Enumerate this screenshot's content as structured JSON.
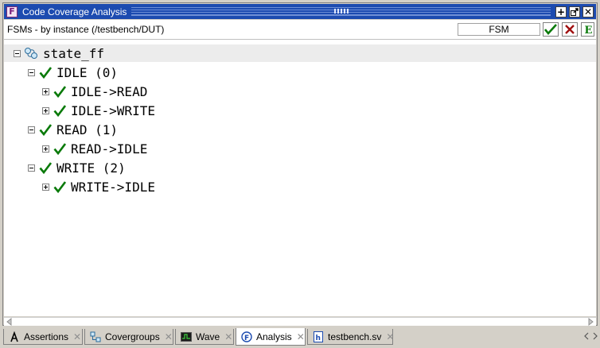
{
  "window": {
    "title": "Code Coverage Analysis",
    "title_buttons": [
      "+",
      "↗",
      "✕"
    ]
  },
  "toolbar": {
    "scope_label": "FSMs - by instance (/testbench/DUT)",
    "filter_value": "FSM",
    "buttons": [
      "check-icon",
      "x-icon",
      "e-icon"
    ]
  },
  "tree": {
    "root": {
      "label": "state_ff",
      "expanded": true
    },
    "states": [
      {
        "label": "IDLE (0)",
        "covered": true,
        "transitions": [
          {
            "label": "IDLE->READ",
            "covered": true
          },
          {
            "label": "IDLE->WRITE",
            "covered": true
          }
        ]
      },
      {
        "label": "READ (1)",
        "covered": true,
        "transitions": [
          {
            "label": "READ->IDLE",
            "covered": true
          }
        ]
      },
      {
        "label": "WRITE (2)",
        "covered": true,
        "transitions": [
          {
            "label": "WRITE->IDLE",
            "covered": true
          }
        ]
      }
    ]
  },
  "tabs": [
    {
      "label": "Assertions",
      "icon": "assertions-icon",
      "active": false
    },
    {
      "label": "Covergroups",
      "icon": "covergroups-icon",
      "active": false
    },
    {
      "label": "Wave",
      "icon": "wave-icon",
      "active": false
    },
    {
      "label": "Analysis",
      "icon": "analysis-icon",
      "active": true
    },
    {
      "label": "testbench.sv",
      "icon": "source-file-icon",
      "active": false
    }
  ],
  "colors": {
    "titlebar": "#1c4bb0",
    "check": "#0a7a0a",
    "x_button": "#a01010",
    "root_row": "#ececec"
  }
}
